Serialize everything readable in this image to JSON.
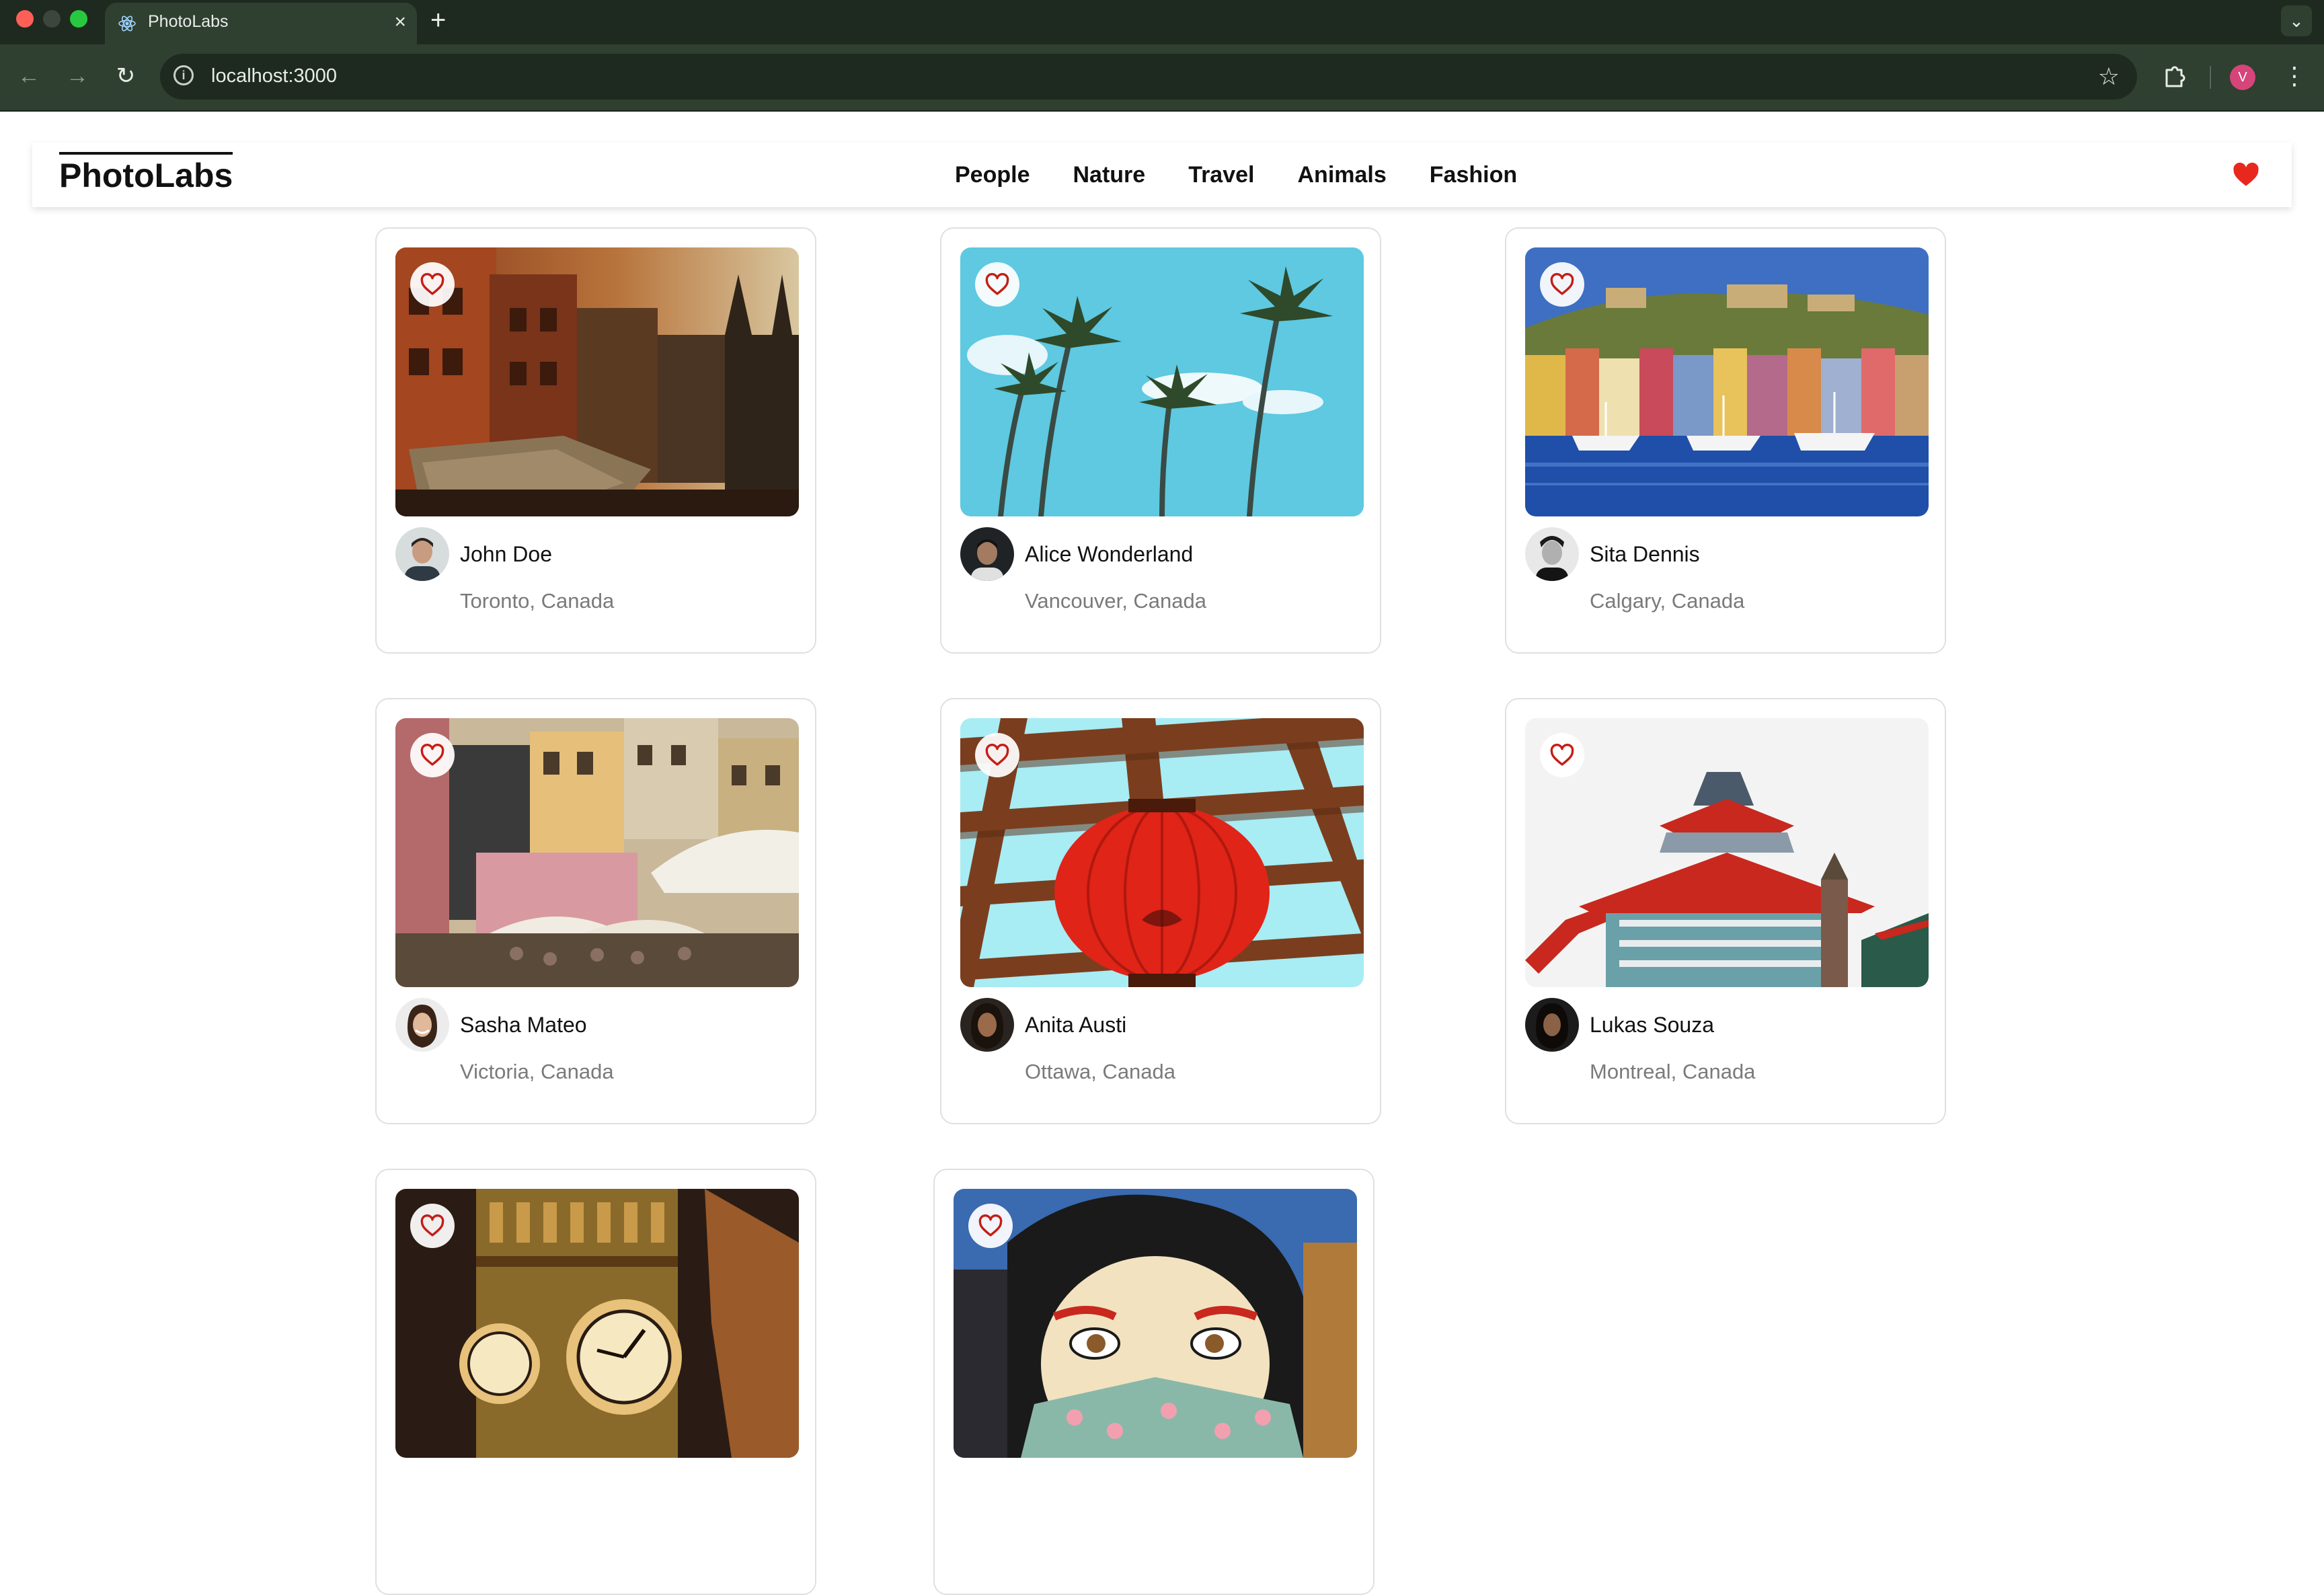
{
  "browser": {
    "tab_title": "PhotoLabs",
    "tab_close": "×",
    "new_tab": "+",
    "url": "localhost:3000",
    "profile_initial": "V"
  },
  "app": {
    "logo": "PhotoLabs",
    "topics": [
      "People",
      "Nature",
      "Travel",
      "Animals",
      "Fashion"
    ],
    "fav_color": "#e8281c"
  },
  "photos": [
    {
      "user": "John Doe",
      "location": "Toronto, Canada",
      "scene": "old-town-buildings-cathedral"
    },
    {
      "user": "Alice Wonderland",
      "location": "Vancouver, Canada",
      "scene": "palm-trees-blue-sky"
    },
    {
      "user": "Sita Dennis",
      "location": "Calgary, Canada",
      "scene": "colorful-harbor-boats"
    },
    {
      "user": "Sasha Mateo",
      "location": "Victoria, Canada",
      "scene": "pink-houses-umbrellas"
    },
    {
      "user": "Anita Austi",
      "location": "Ottawa, Canada",
      "scene": "red-lantern-pergola"
    },
    {
      "user": "Lukas Souza",
      "location": "Montreal, Canada",
      "scene": "pagoda-roof"
    },
    {
      "user": "",
      "location": "",
      "scene": "clock-tower-night"
    },
    {
      "user": "",
      "location": "",
      "scene": "geisha-mural"
    }
  ]
}
